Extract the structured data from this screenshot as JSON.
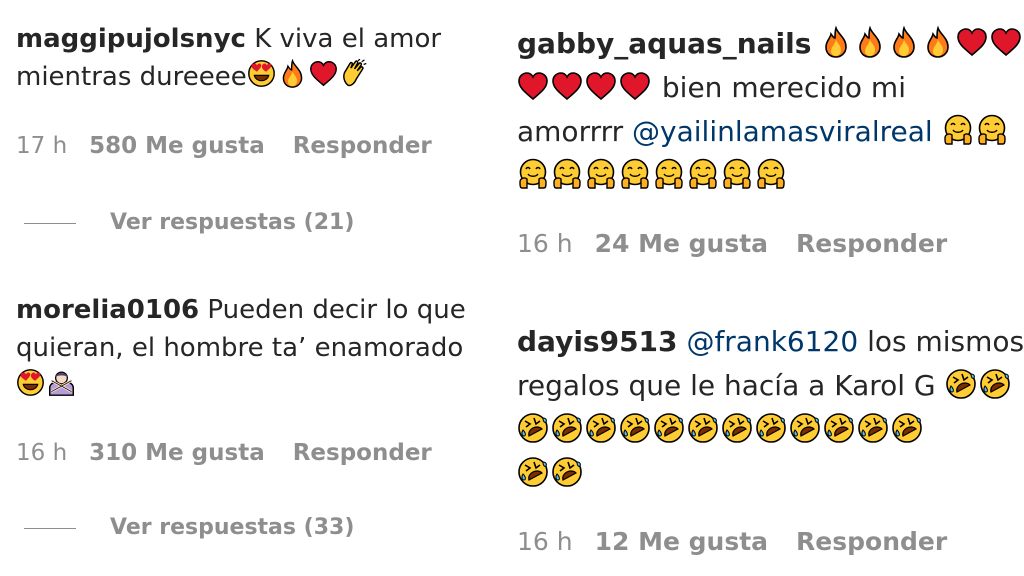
{
  "left_comments": [
    {
      "username": "maggipujolsnyc",
      "text_line1": " K viva el amor",
      "text_line2": "mientras dureeee",
      "emojis": [
        "heart-eyes",
        "fire",
        "red-heart",
        "clapping-hands"
      ],
      "time": "17 h",
      "likes": "580 Me gusta",
      "reply": "Responder",
      "view_replies": "Ver respuestas (21)"
    },
    {
      "username": "morelia0106",
      "text_line1": " Pueden decir lo que",
      "text_line2": "quieran, el hombre ta’ enamorado",
      "emojis": [
        "heart-eyes",
        "no-gesture-person"
      ],
      "time": "16 h",
      "likes": "310 Me gusta",
      "reply": "Responder",
      "view_replies": "Ver respuestas (33)"
    }
  ],
  "right_comments": [
    {
      "username": "gabby_aquas_nails",
      "emojis_line1": [
        "fire",
        "fire",
        "fire",
        "fire",
        "red-heart",
        "red-heart"
      ],
      "emojis_line2": [
        "red-heart",
        "red-heart",
        "red-heart",
        "red-heart"
      ],
      "text_line2": " bien merecido mi",
      "text_line3": "amorrrr ",
      "mention": "@yailinlamasviralreal",
      "emojis_line3": [
        "hugging-face",
        "hugging-face"
      ],
      "emojis_line4": [
        "hugging-face",
        "hugging-face",
        "hugging-face",
        "hugging-face",
        "hugging-face",
        "hugging-face",
        "hugging-face",
        "hugging-face"
      ],
      "time": "16 h",
      "likes": "24 Me gusta",
      "reply": "Responder"
    },
    {
      "username": "dayis9513",
      "mention": "@frank6120",
      "text_line1": " los mismos",
      "text_line2": "regalos que le hacía a Karol G ",
      "emojis_line2": [
        "rolling-laughing",
        "rolling-laughing"
      ],
      "emojis_line3": [
        "rolling-laughing",
        "rolling-laughing",
        "rolling-laughing",
        "rolling-laughing",
        "rolling-laughing",
        "rolling-laughing",
        "rolling-laughing",
        "rolling-laughing",
        "rolling-laughing",
        "rolling-laughing",
        "rolling-laughing",
        "rolling-laughing"
      ],
      "emojis_line4": [
        "rolling-laughing",
        "rolling-laughing"
      ],
      "time": "16 h",
      "likes": "12 Me gusta",
      "reply": "Responder"
    }
  ],
  "colors": {
    "text": "#262626",
    "meta": "#8e8e8e",
    "mention": "#00376b",
    "emoji_yellow": "#ffcc33",
    "emoji_red": "#e0162b",
    "emoji_orange": "#ff7b1a"
  }
}
